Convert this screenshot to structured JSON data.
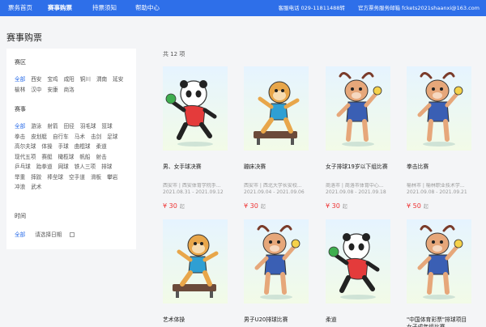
{
  "nav": {
    "items": [
      "票务首页",
      "赛事购票",
      "持票须知",
      "帮助中心"
    ],
    "hotline": "客服电话 029-11811488转",
    "email": "官方票务服务邮箱 fckets2021shaanxi@163.com"
  },
  "page_title": "赛事购票",
  "filters": {
    "region_title": "赛区",
    "regions": [
      "全部",
      "西安",
      "宝鸡",
      "咸阳",
      "铜川",
      "渭南",
      "延安",
      "榆林",
      "汉中",
      "安康",
      "商洛"
    ],
    "event_title": "赛事",
    "events": [
      "全部",
      "游泳",
      "射箭",
      "田径",
      "羽毛球",
      "篮球",
      "拳击",
      "皮划艇",
      "自行车",
      "马术",
      "击剑",
      "足球",
      "高尔夫球",
      "体操",
      "手球",
      "曲棍球",
      "柔道",
      "现代五项",
      "赛艇",
      "橄榄球",
      "帆船",
      "射击",
      "乒乓球",
      "跆拳道",
      "网球",
      "铁人三项",
      "排球",
      "举重",
      "摔跤",
      "棒垒球",
      "空手道",
      "滑板",
      "攀岩",
      "冲浪",
      "武术"
    ],
    "time_title": "时间",
    "time_all": "全部",
    "date_placeholder": "请选择日期"
  },
  "result_count": "共 12 项",
  "cards": [
    {
      "title": "男、女手球决赛",
      "meta1": "西安市 | 西安体育学院手...",
      "meta2": "2021.08.31 - 2021.09.12",
      "price": "¥ 30",
      "unit": "起",
      "mascot": "panda"
    },
    {
      "title": "蹦床决赛",
      "meta1": "西安市 | 西北大学长安校...",
      "meta2": "2021.09.04 - 2021.09.06",
      "price": "¥ 30",
      "unit": "起",
      "mascot": "monkey"
    },
    {
      "title": "女子排球19岁以下组比赛",
      "meta1": "商洛市 | 商洛市体育中心...",
      "meta2": "2021.09.08 - 2021.09.18",
      "price": "¥ 30",
      "unit": "起",
      "mascot": "goat"
    },
    {
      "title": "拳击比赛",
      "meta1": "榆林市 | 榆林职业技术学...",
      "meta2": "2021.09.08 - 2021.09.21",
      "price": "¥ 50",
      "unit": "起",
      "mascot": "goat"
    },
    {
      "title": "艺术体操",
      "mascot": "monkey"
    },
    {
      "title": "男子U20排球比赛",
      "mascot": "goat"
    },
    {
      "title": "柔道",
      "mascot": "panda"
    },
    {
      "title": "\"中国体育彩票\"排球项目女子成年组比赛",
      "mascot": "goat"
    }
  ],
  "colors": {
    "accent": "#2e6fe9",
    "price": "#e33333"
  }
}
